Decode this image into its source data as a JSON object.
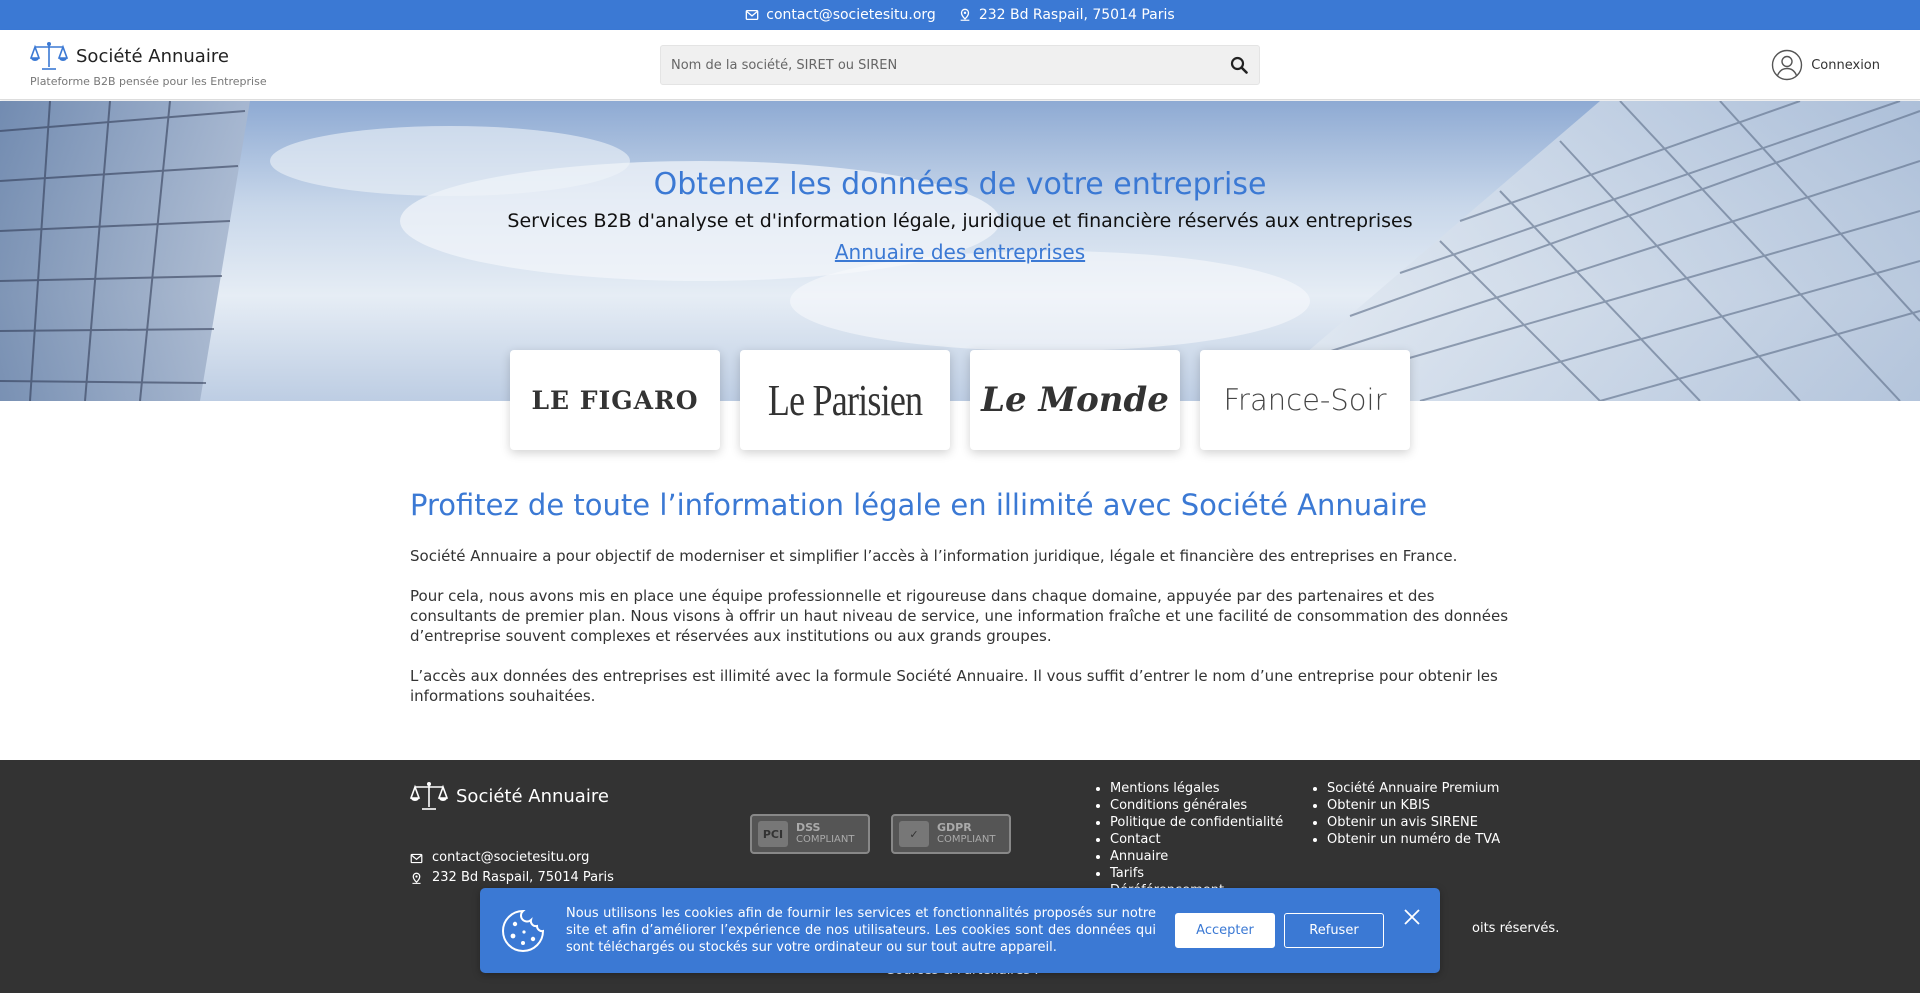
{
  "topbar": {
    "email": "contact@societesitu.org",
    "address": "232 Bd Raspail, 75014 Paris"
  },
  "header": {
    "brand_name": "Société Annuaire",
    "tagline": "Plateforme B2B pensée pour les Entreprise",
    "search_placeholder": "Nom de la société, SIRET ou SIREN",
    "login_label": "Connexion"
  },
  "hero": {
    "title": "Obtenez les données de votre entreprise",
    "subtitle": "Services B2B d'analyse et d'information légale, juridique et financière réservés aux entreprises",
    "link": "Annuaire des entreprises"
  },
  "press": [
    "LE FIGARO",
    "Le Parisien",
    "Le Monde",
    "France-Soir"
  ],
  "main": {
    "heading": "Profitez de toute l’information légale en illimité avec Société Annuaire",
    "p1": "Société Annuaire a pour objectif de moderniser et simplifier l’accès à l’information juridique, légale et financière des entreprises en France.",
    "p2": "Pour cela, nous avons mis en place une équipe professionnelle et rigoureuse dans chaque domaine, appuyée par des partenaires et des consultants de premier plan. Nous visons à offrir un haut niveau de service, une information fraîche et une facilité de consommation des données d’entreprise souvent complexes et réservées aux institutions ou aux grands groupes.",
    "p3": "L’accès aux données des entreprises est illimité avec la formule Société Annuaire. Il vous suffit d’entrer le nom d’une entreprise pour obtenir les informations souhaitées."
  },
  "footer": {
    "brand_name": "Société Annuaire",
    "email": "contact@societesitu.org",
    "address": "232 Bd Raspail, 75014 Paris",
    "badges": [
      {
        "icon": "PCI",
        "line1": "DSS",
        "line2": "COMPLIANT"
      },
      {
        "icon": "✓",
        "line1": "GDPR",
        "line2": "COMPLIANT"
      }
    ],
    "links_col1": [
      "Mentions légales",
      "Conditions générales",
      "Politique de confidentialité",
      "Contact",
      "Annuaire",
      "Tarifs",
      "Déréférencement"
    ],
    "links_col2": [
      "Société Annuaire Premium",
      "Obtenir un KBIS",
      "Obtenir un avis SIRENE",
      "Obtenir un numéro de TVA"
    ],
    "rights": "oits réservés.",
    "sources": "Sources & Partenaires :"
  },
  "cookie": {
    "text": "Nous utilisons les cookies afin de fournir les services et fonctionnalités proposés sur notre site et afin d’améliorer l’expérience de nos utilisateurs. Les cookies sont des données qui sont téléchargés ou stockés sur votre ordinateur ou sur tout autre appareil.",
    "accept": "Accepter",
    "refuse": "Refuser"
  },
  "colors": {
    "primary": "#3b79d4",
    "footer_bg": "#333333"
  }
}
